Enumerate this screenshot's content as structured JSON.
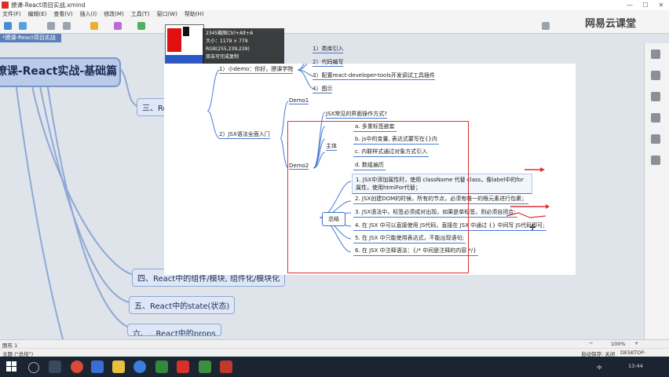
{
  "window": {
    "title": "撩课-React项目实战.xmind",
    "min": "—",
    "max": "☐",
    "close": "✕"
  },
  "menu": [
    "文件(F)",
    "编辑(E)",
    "查看(V)",
    "插入(I)",
    "修改(M)",
    "工具(T)",
    "窗口(W)",
    "帮助(H)"
  ],
  "brand": "网易云课堂",
  "tab": "*撩课-React项目实战",
  "capture": {
    "line1": "2345截图Ctrl+Alt+A",
    "line2": "大小：1179 × 779",
    "line3": "RGB(255,239,239)",
    "line4": "双击可完成复制"
  },
  "map": {
    "main_topic": "撩课-React实战-基础篇",
    "t3": "三、React初体验",
    "t4": "四、React中的组件/模块, 组件化/模块化",
    "t5": "五、React中的state(状态)",
    "t6": "六、...React中的props",
    "sub1": "1）小demo：你好，撩课学院",
    "sub2": "2）JSX语法全面入门",
    "s1_items": [
      "1）类库引入",
      "2）代码编写",
      "3）配置react-developer-tools开发调试工具插件",
      "4）图示"
    ],
    "demo1": "Demo1",
    "demo2": "Demo2",
    "jsx_q": "JSX常见的界面操作方式?",
    "zhuti": "主体",
    "zhuti_items": [
      "a. 多重标签嵌套",
      "b. js中的变量, 表达式要写在{}内",
      "c. 内联样式通过对象方式引入",
      "d. 数组遍历"
    ],
    "zongjie": "总结",
    "summary_items": [
      "1. JSX中添加属性时，使用 className 代替 class，像label中的for属性，使用htmlFor代替；",
      "2. JSX创建DOM的时候，所有的节点，必须有唯一的根元素进行包裹；",
      "3. JSX语法中，标签必须成对出现，如果是单标签，则必须自闭合;",
      "4. 在 JSX 中可以直接使用 JS代码，直接在 JSX 中通过 {} 中间写 JS代码即可;",
      "5. 在 JSX 中只能使用表达式，不能出现语句;",
      "6. 在 JSX 中注释语法：{/* 中间是注释的内容 */}"
    ]
  },
  "status": {
    "sheet": "图布 1",
    "topic": "主题 (\"总结\")",
    "autosave": "自动保存: 关闭",
    "user": "DESKTOP-QF1BP5S",
    "zoom": "100%",
    "zoom_minus": "−",
    "zoom_plus": "+"
  },
  "taskbar": {
    "time": "13:44",
    "lang": "中"
  },
  "colors": {
    "red_box": "#e03030",
    "node_border": "#8ea9d6",
    "taskbar": "#1b2532"
  }
}
